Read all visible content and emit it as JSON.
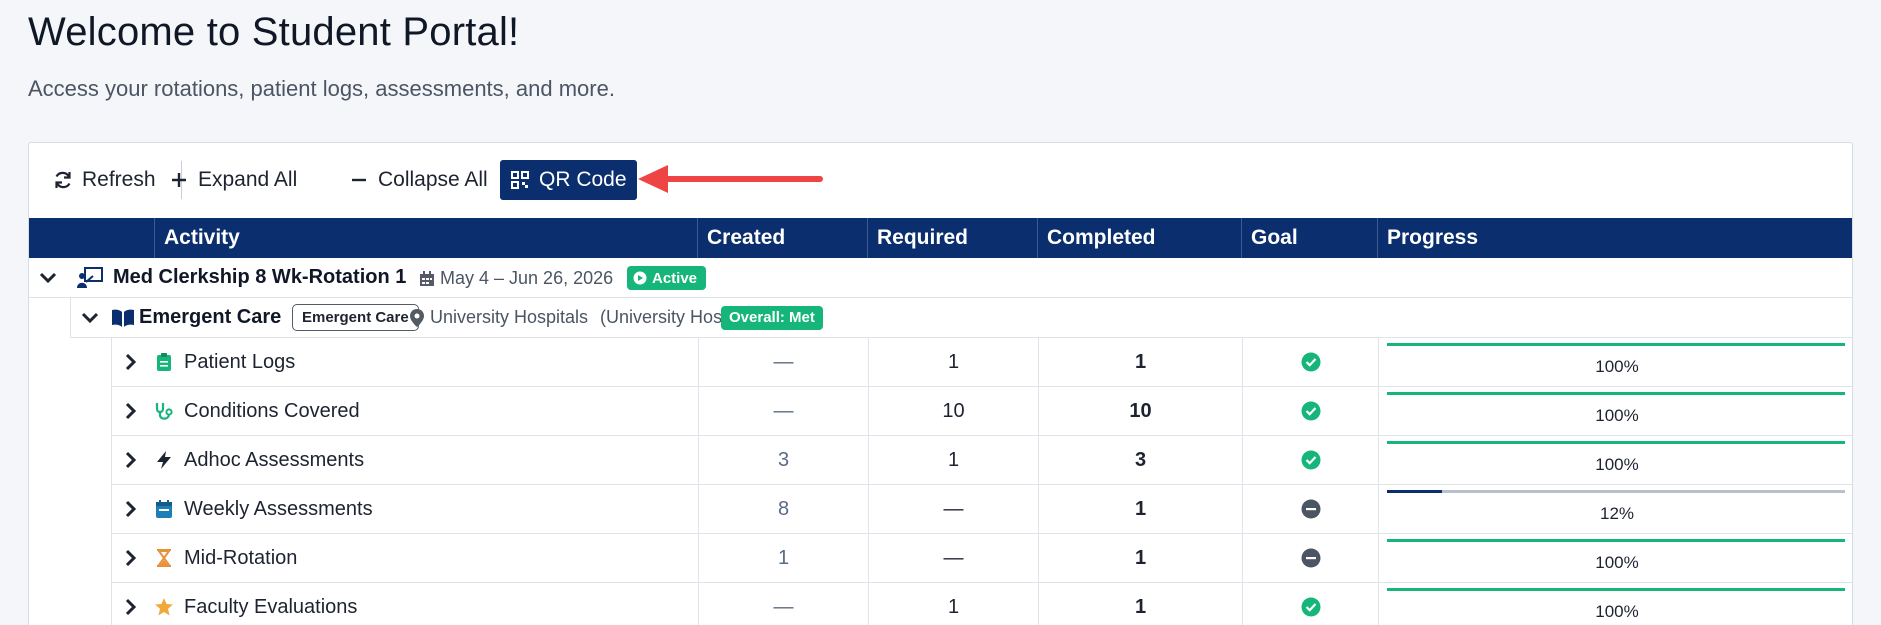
{
  "header": {
    "title": "Welcome to Student Portal!",
    "subtitle": "Access your rotations, patient logs, assessments, and more."
  },
  "toolbar": {
    "refresh_label": "Refresh",
    "expand_label": "Expand All",
    "collapse_label": "Collapse All",
    "qr_label": "QR Code"
  },
  "table": {
    "columns": [
      "Activity",
      "Created",
      "Required",
      "Completed",
      "Goal",
      "Progress"
    ]
  },
  "rotation": {
    "title": "Med Clerkship 8 Wk-Rotation 1",
    "dates": "May 4 – Jun 26, 2026",
    "status": "Active"
  },
  "clerkship": {
    "title": "Emergent Care",
    "tag": "Emergent Care",
    "location": "University Hospitals",
    "location_parent": "(University Hospitals)",
    "overall": "Overall: Met"
  },
  "activities": [
    {
      "name": "Patient Logs",
      "icon": "clipboard-icon",
      "created": "—",
      "required": "1",
      "completed": "1",
      "goal": "met",
      "progress": 100,
      "progress_label": "100%"
    },
    {
      "name": "Conditions Covered",
      "icon": "stethoscope-icon",
      "created": "—",
      "required": "10",
      "completed": "10",
      "goal": "met",
      "progress": 100,
      "progress_label": "100%"
    },
    {
      "name": "Adhoc Assessments",
      "icon": "bolt-icon",
      "created": "3",
      "required": "1",
      "completed": "3",
      "goal": "met",
      "progress": 100,
      "progress_label": "100%"
    },
    {
      "name": "Weekly Assessments",
      "icon": "calendar-icon",
      "created": "8",
      "required": "—",
      "completed": "1",
      "goal": "pending",
      "progress": 12,
      "progress_label": "12%"
    },
    {
      "name": "Mid-Rotation",
      "icon": "hourglass-icon",
      "created": "1",
      "required": "—",
      "completed": "1",
      "goal": "pending",
      "progress": 100,
      "progress_label": "100%"
    },
    {
      "name": "Faculty Evaluations",
      "icon": "star-icon",
      "created": "—",
      "required": "1",
      "completed": "1",
      "goal": "met",
      "progress": 100,
      "progress_label": "100%"
    }
  ],
  "colors": {
    "primary": "#0b2e6e",
    "success": "#16b57a",
    "pending": "#4b5563",
    "arrow": "#ef4444"
  }
}
